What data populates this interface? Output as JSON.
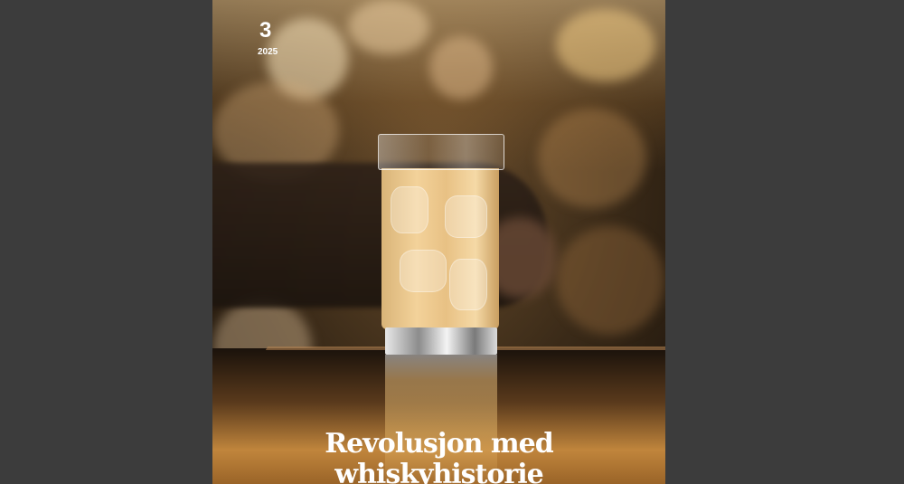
{
  "cover": {
    "issue_number": "3",
    "issue_year": "2025",
    "headline_line1": "Revolusjon med",
    "headline_line2": "whiskyhistorie"
  },
  "colors": {
    "viewer_background": "#3c3c3c",
    "headline_text": "#ffffff"
  }
}
